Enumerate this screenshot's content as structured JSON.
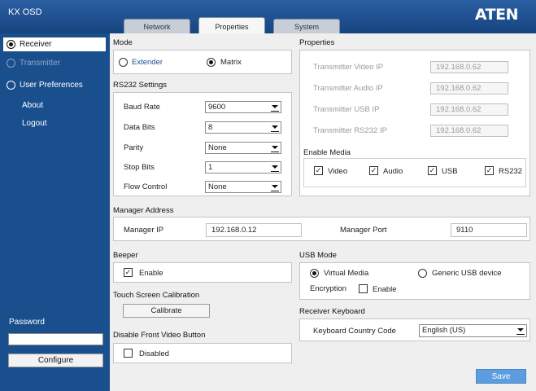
{
  "app_title": "KX OSD",
  "brand": "ATEN",
  "tabs": [
    {
      "label": "Network"
    },
    {
      "label": "Properties"
    },
    {
      "label": "System"
    }
  ],
  "sidebar": {
    "items": [
      {
        "label": "Receiver"
      },
      {
        "label": "Transmitter"
      },
      {
        "label": "User Preferences"
      },
      {
        "label": "About"
      },
      {
        "label": "Logout"
      }
    ],
    "password_label": "Password",
    "password_value": "",
    "configure_label": "Configure"
  },
  "mode": {
    "title": "Mode",
    "extender": "Extender",
    "matrix": "Matrix"
  },
  "rs232": {
    "title": "RS232 Settings",
    "rows": [
      {
        "label": "Baud Rate",
        "value": "9600"
      },
      {
        "label": "Data Bits",
        "value": "8"
      },
      {
        "label": "Parity",
        "value": "None"
      },
      {
        "label": "Stop Bits",
        "value": "1"
      },
      {
        "label": "Flow Control",
        "value": "None"
      }
    ]
  },
  "properties": {
    "title": "Properties",
    "rows": [
      {
        "label": "Transmitter Video IP",
        "value": "192.168.0.62"
      },
      {
        "label": "Transmitter Audio IP",
        "value": "192.168.0.62"
      },
      {
        "label": "Transmitter USB IP",
        "value": "192.168.0.62"
      },
      {
        "label": "Transmitter RS232 IP",
        "value": "192.168.0.62"
      }
    ],
    "enable_media_title": "Enable Media",
    "media": [
      {
        "label": "Video"
      },
      {
        "label": "Audio"
      },
      {
        "label": "USB"
      },
      {
        "label": "RS232"
      }
    ]
  },
  "manager": {
    "title": "Manager Address",
    "ip_label": "Manager IP",
    "ip_value": "192.168.0.12",
    "port_label": "Manager Port",
    "port_value": "9110"
  },
  "beeper": {
    "title": "Beeper",
    "enable_label": "Enable"
  },
  "touch": {
    "title": "Touch Screen Calibration",
    "calibrate_label": "Calibrate"
  },
  "front_video": {
    "title": "Disable Front Video Button",
    "disabled_label": "Disabled"
  },
  "usb_mode": {
    "title": "USB Mode",
    "virtual_media": "Virtual Media",
    "generic": "Generic USB device",
    "encryption_label": "Encryption",
    "enable_label": "Enable"
  },
  "keyboard": {
    "title": "Receiver Keyboard",
    "code_label": "Keyboard Country Code",
    "code_value": "English (US)"
  },
  "save_label": "Save",
  "colors": {
    "sidebar_bg": "#1a4f8e",
    "header_bg": "#16447f",
    "save_bg": "#5b9de0"
  }
}
